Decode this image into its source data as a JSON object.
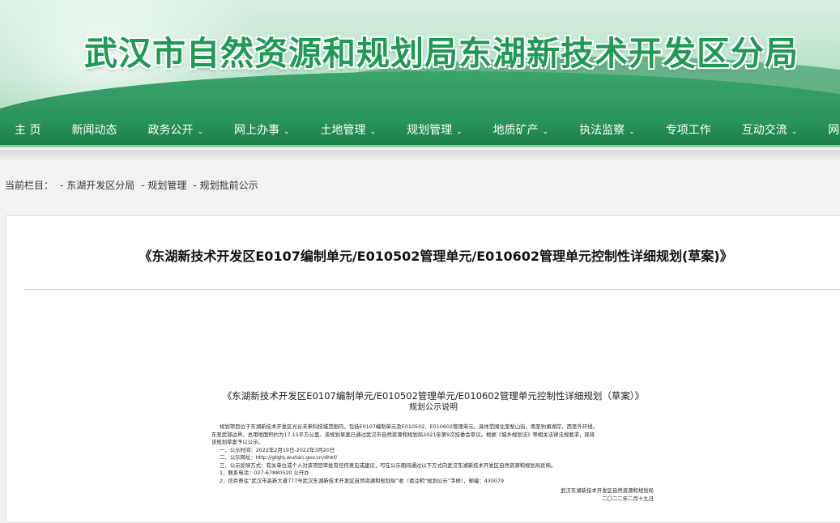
{
  "header": {
    "site_title": "武汉市自然资源和规划局东湖新技术开发区分局"
  },
  "nav": {
    "items": [
      {
        "label": "主 页",
        "has_dropdown": false
      },
      {
        "label": "新闻动态",
        "has_dropdown": false
      },
      {
        "label": "政务公开",
        "has_dropdown": true
      },
      {
        "label": "网上办事",
        "has_dropdown": true
      },
      {
        "label": "土地管理",
        "has_dropdown": true
      },
      {
        "label": "规划管理",
        "has_dropdown": true
      },
      {
        "label": "地质矿产",
        "has_dropdown": true
      },
      {
        "label": "执法监察",
        "has_dropdown": true
      },
      {
        "label": "专项工作",
        "has_dropdown": false
      },
      {
        "label": "互动交流",
        "has_dropdown": true
      },
      {
        "label": "网上信箱",
        "has_dropdown": false
      }
    ],
    "caret": "⌄"
  },
  "breadcrumb": {
    "prefix": "当前栏目：",
    "items": [
      "东湖开发区分局",
      "规划管理",
      "规划批前公示"
    ],
    "separator": "-"
  },
  "article": {
    "title": "《东湖新技术开发区E0107编制单元/E010502管理单元/E010602管理单元控制性详细规划(草案)》"
  },
  "notice": {
    "title": "《东湖新技术开发区E0107编制单元/E010502管理单元/E010602管理单元控制性详细规划（草案）》",
    "subtitle": "规划公示说明",
    "para1_line1": "规划项目位于东湖新技术开发区光谷未来科技城范围内，包括E0107编制单元及E010502、E010602管理单元，具体范围北至梨山街，南至豹澥湖岸，西至外环线，",
    "para1_line2": "东至武鄂边界，总用地面积约为17.15平方公里。该规划草案已通过武汉市自然资源和规划局2021年第9次技委会审议。根据《城乡规划法》等相关法律法规要求，现将",
    "para1_line3": "该规划草案予以公示。",
    "item1": "一、公示时间：2022年2月19日-2022年3月20日",
    "item2": "二、公示网址：http://gtghj.wuhan.gov.cn/dhkf/",
    "item3": "三、公示反映方式：有关单位或个人对该项目审批有任何意见或建议，可在公示期间通过以下方式向武汉东湖新技术开发区自然资源和规划局反映。",
    "item3_1": "1．联系电话：027-67880520 公开办",
    "item3_2": "2．信件寄往“武汉市高新大道777号武汉东湖新技术开发区自然资源和规划局”收（请注明“规划公示”字样），邮编：430079",
    "sign_org": "武汉东湖新技术开发区自然资源和规划局",
    "sign_date": "二〇二二年二月十九日"
  }
}
